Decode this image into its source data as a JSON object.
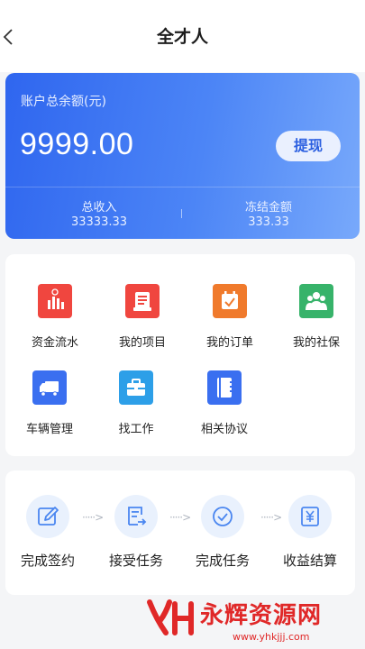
{
  "header": {
    "title": "全才人"
  },
  "balance": {
    "label": "账户总余额(元)",
    "amount": "9999.00",
    "withdraw_label": "提现",
    "income_label": "总收入",
    "income_value": "33333.33",
    "frozen_label": "冻结金额",
    "frozen_value": "333.33"
  },
  "menu": {
    "items": [
      {
        "label": "资金流水",
        "icon": "bar-chart-icon",
        "color": "#f0463f"
      },
      {
        "label": "我的项目",
        "icon": "project-icon",
        "color": "#f0463f"
      },
      {
        "label": "我的订单",
        "icon": "order-icon",
        "color": "#f07a2c"
      },
      {
        "label": "我的社保",
        "icon": "people-icon",
        "color": "#37b36a"
      },
      {
        "label": "车辆管理",
        "icon": "truck-icon",
        "color": "#3a6ff0"
      },
      {
        "label": "找工作",
        "icon": "briefcase-icon",
        "color": "#2d9fe8"
      },
      {
        "label": "相关协议",
        "icon": "notebook-icon",
        "color": "#3a6ff0"
      }
    ]
  },
  "flow": {
    "steps": [
      {
        "label": "完成签约",
        "icon": "edit-icon"
      },
      {
        "label": "接受任务",
        "icon": "task-icon"
      },
      {
        "label": "完成任务",
        "icon": "check-circle-icon"
      },
      {
        "label": "收益结算",
        "icon": "yen-icon"
      }
    ],
    "arrow": "·····>"
  },
  "watermark": {
    "name": "永辉资源网",
    "url": "www.yhkjjj.com"
  },
  "colors": {
    "accent": "#2f66ef",
    "accent_light": "#78a9fb",
    "flow_icon": "#4a86f0",
    "watermark": "#e02828"
  }
}
